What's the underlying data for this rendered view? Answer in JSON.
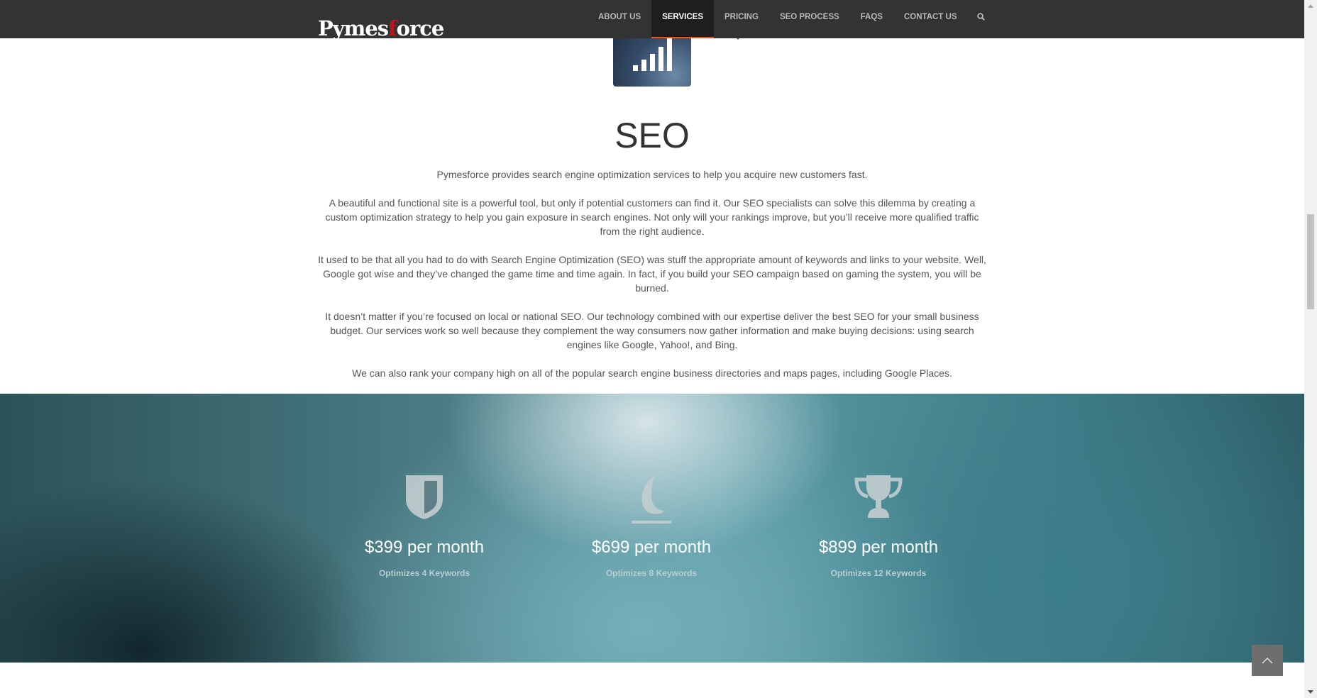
{
  "header": {
    "logo": {
      "part1": "Pymes",
      "accent": "f",
      "part2": "orce"
    },
    "nav": [
      {
        "label": "ABOUT US",
        "active": false
      },
      {
        "label": "SERVICES",
        "active": true
      },
      {
        "label": "PRICING",
        "active": false
      },
      {
        "label": "SEO PROCESS",
        "active": false
      },
      {
        "label": "FAQS",
        "active": false
      },
      {
        "label": "CONTACT US",
        "active": false
      }
    ],
    "search_icon": "search-icon"
  },
  "seo": {
    "icon": "signal-bars-icon",
    "title": "SEO",
    "paragraphs": [
      "Pymesforce provides search engine optimization services to help you acquire new customers fast.",
      "A beautiful and functional site is a powerful tool, but only if potential customers can find it. Our SEO specialists can solve this dilemma by creating a custom optimization strategy to help you gain exposure in search engines. Not only will your rankings improve, but you’ll receive more qualified traffic from the right audience.",
      "It used to be that all you had to do with Search Engine Optimization (SEO) was stuff the appropriate amount of keywords and links to your website. Well, Google got wise and they’ve changed the game time and time again. In fact, if you build your SEO campaign based on gaming the system, you will be burned.",
      "It doesn’t matter if you’re focused on local or national SEO. Our technology combined with our expertise deliver the best SEO for your small business budget. Our services work so well because they complement the way consumers now gather information and make buying decisions: using search engines like Google, Yahoo!, and Bing.",
      "We can also rank your company high on all of the popular search engine business directories and maps pages, including Google Places."
    ]
  },
  "pricing": {
    "plans": [
      {
        "icon": "shield-icon",
        "price": "$399 per month",
        "sub": "Optimizes 4 Keywords"
      },
      {
        "icon": "flame-icon",
        "price": "$699 per month",
        "sub": "Optimizes 8 Keywords"
      },
      {
        "icon": "trophy-icon",
        "price": "$899 per month",
        "sub": "Optimizes 12 Keywords"
      }
    ]
  },
  "colors": {
    "header_bg": "#333333",
    "nav_active_underline": "#e8541f",
    "logo_accent": "#c0141b"
  },
  "back_to_top_icon": "chevron-up-icon"
}
